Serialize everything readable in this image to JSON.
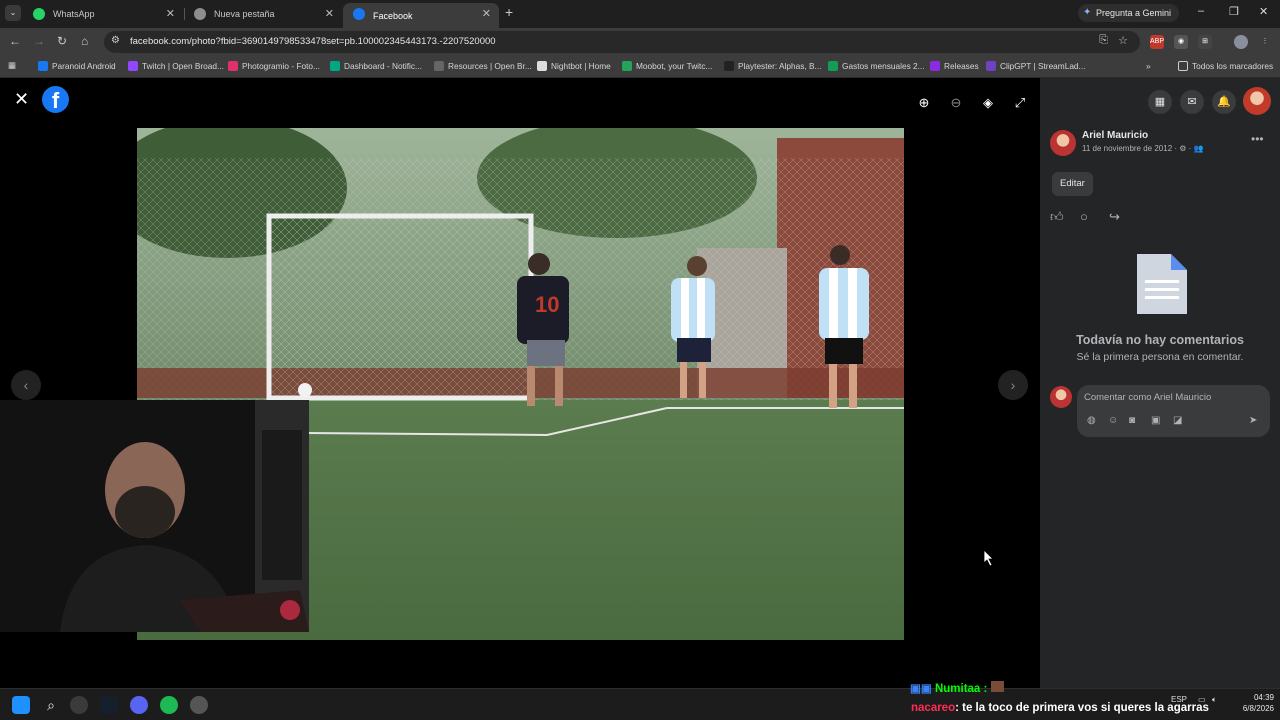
{
  "browser": {
    "tabs": [
      {
        "title": "WhatsApp",
        "active": false,
        "favicon": "whatsapp-icon",
        "color": "#25d366"
      },
      {
        "title": "Nueva pestaña",
        "active": false,
        "favicon": "globe-icon",
        "color": "#8e8e8e"
      },
      {
        "title": "Facebook",
        "active": true,
        "favicon": "facebook-icon",
        "color": "#1877f2"
      }
    ],
    "new_tab_label": "+",
    "gemini_label": "Pregunta a Gemini",
    "url": "facebook.com/photo?fbid=3690149798533478set=pb.100002345443173.-2207520000",
    "bookmarks": [
      {
        "label": "Paranoid Android",
        "color": "#1877f2"
      },
      {
        "label": "Twitch | Open Broad...",
        "color": "#9146ff"
      },
      {
        "label": "Photogramio - Foto...",
        "color": "#e1306c"
      },
      {
        "label": "Dashboard - Notific...",
        "color": "#00a884"
      },
      {
        "label": "Resources | Open Br...",
        "color": "#666666"
      },
      {
        "label": "Nightbot | Home",
        "color": "#dddddd"
      },
      {
        "label": "Moobot, your Twitc...",
        "color": "#23a559"
      },
      {
        "label": "Playtester: Alphas, B...",
        "color": "#222222"
      },
      {
        "label": "Gastos mensuales 2...",
        "color": "#0f9d58"
      },
      {
        "label": "Releases",
        "color": "#8a2be2"
      },
      {
        "label": "ClipGPT | StreamLad...",
        "color": "#6f42c1"
      }
    ],
    "bookmarks_overflow": "»",
    "all_bookmarks_label": "Todos los marcadores"
  },
  "viewer": {
    "close_icon": "close-icon",
    "logo_letter": "f",
    "tools": [
      "zoom-in-icon",
      "zoom-out-icon",
      "tag-icon",
      "fullscreen-icon"
    ]
  },
  "panel": {
    "author": "Ariel Mauricio",
    "date": "11 de noviembre de 2012 · ⚙ · 👥",
    "edit_label": "Editar",
    "no_comments_title": "Todavía no hay comentarios",
    "no_comments_sub": "Sé la primera persona en comentar.",
    "comment_placeholder": "Comentar como Ariel Mauricio"
  },
  "chat": {
    "line1_user": "Numitaa :",
    "line2_user": "nacareo",
    "line2_text": ": te la toco de primera vos si queres la agarras",
    "line1_color": "#00ff00",
    "line2_color": "#ff2d55"
  },
  "system": {
    "lang": "ESP",
    "time": "04:39",
    "date": "6/8/2026"
  }
}
